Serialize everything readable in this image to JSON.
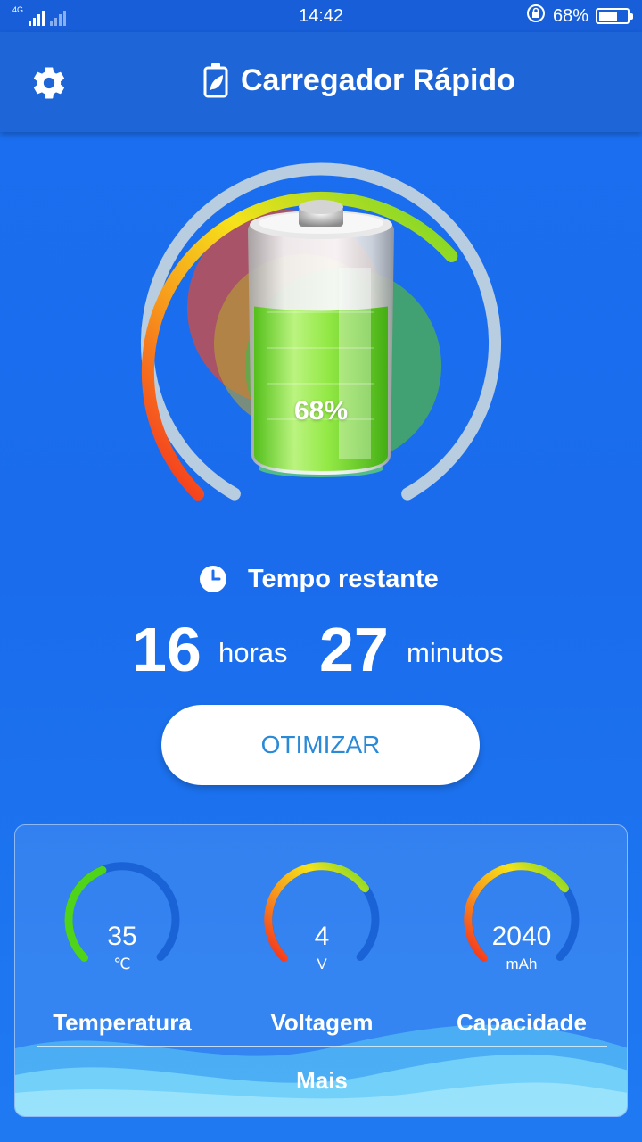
{
  "status_bar": {
    "network": "4G",
    "time": "14:42",
    "battery_text": "68%",
    "battery_level": 0.68
  },
  "app_bar": {
    "title": "Carregador Rápido"
  },
  "gauge": {
    "percent_label": "68%",
    "charge_level": 0.68,
    "colors": {
      "red": "#f42d1f",
      "orange": "#f79a1c",
      "yellow": "#f6e21a",
      "green": "#6ed62a",
      "track": "#b9cde0"
    }
  },
  "time_remaining": {
    "label": "Tempo restante",
    "hours": "16",
    "hours_unit": "horas",
    "minutes": "27",
    "minutes_unit": "minutos"
  },
  "optimize_button": {
    "label": "OTIMIZAR"
  },
  "stats": [
    {
      "value": "35",
      "unit": "℃",
      "label": "Temperatura",
      "level": 0.42
    },
    {
      "value": "4",
      "unit": "V",
      "label": "Voltagem",
      "level": 0.7
    },
    {
      "value": "2040",
      "unit": "mAh",
      "label": "Capacidade",
      "level": 0.7
    }
  ],
  "more_button": {
    "label": "Mais"
  }
}
